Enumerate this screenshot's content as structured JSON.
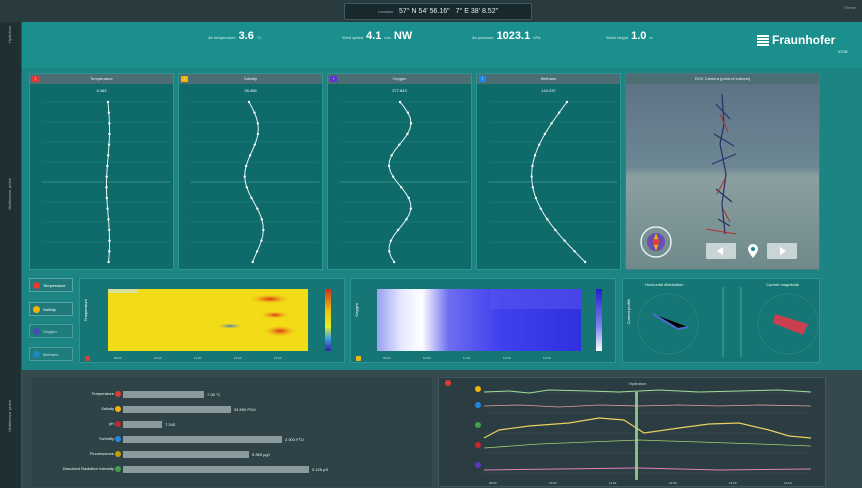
{
  "window": {
    "corner_label": "Theme"
  },
  "coords": {
    "lat_label": "Location",
    "lat": "57° N 54' 56.16\"",
    "lon": "7° E 38' 8.52\""
  },
  "sidebar": {
    "top_label": "Hydrobox",
    "mid_label": "Multisensor probe",
    "low_label": "Multisensor probe"
  },
  "header": {
    "air_temp": {
      "label": "Air temperature",
      "value": "3.6",
      "unit": "°C"
    },
    "wind": {
      "label": "Wind speed",
      "value": "4.1",
      "unit": "m/s",
      "dir": "NW"
    },
    "pressure": {
      "label": "Air pressure",
      "value": "1023.1",
      "unit": "hPa"
    },
    "wave": {
      "label": "Wave height",
      "value": "1.0",
      "unit": "m"
    },
    "logo_name": "Fraunhofer",
    "logo_sub": "IOSB",
    "logo_color": "#ffffff"
  },
  "profiles": [
    {
      "title": "Temperature",
      "value": "4.163",
      "color": "#e53935"
    },
    {
      "title": "Salinity",
      "value": "35.496",
      "color": "#f4b400"
    },
    {
      "title": "Oxygen",
      "value": "277.843",
      "color": "#5c35cc"
    },
    {
      "title": "Methane",
      "value": "144.237",
      "color": "#1e88e5"
    }
  ],
  "image_panel": {
    "title": "ROV Camera (point of interest)"
  },
  "controls": [
    {
      "label": "Temperature",
      "color": "#e53935"
    },
    {
      "label": "Salinity",
      "color": "#f4b400"
    },
    {
      "label": "Oxygen",
      "color": "#5c35cc"
    },
    {
      "label": "Methane",
      "color": "#1e88e5"
    }
  ],
  "heatmaps": [
    {
      "ylabel": "Temperature",
      "color": "#e53935"
    },
    {
      "ylabel": "Oxygen",
      "color": "#f4b400"
    }
  ],
  "current_panel": {
    "label": "Current profile",
    "t1": "Horizontal distribution",
    "t2": "Current magnitude"
  },
  "bars": [
    {
      "label": "Temperature",
      "value": "7.08",
      "unit": "°C",
      "color": "#e53935",
      "fraction": 0.27
    },
    {
      "label": "Salinity",
      "value": "34.590",
      "unit": "PSU",
      "color": "#f4b400",
      "fraction": 0.36
    },
    {
      "label": "pH",
      "value": "7.245",
      "unit": "",
      "color": "#c62828",
      "fraction": 0.13
    },
    {
      "label": "Turbidity",
      "value": "2.003",
      "unit": "FTU",
      "color": "#1e88e5",
      "fraction": 0.53
    },
    {
      "label": "Fluorescence",
      "value": "0.369",
      "unit": "µg/l",
      "color": "#c0a000",
      "fraction": 0.42
    },
    {
      "label": "Dissolved Radiation Intensity",
      "value": "0.126",
      "unit": "µS",
      "color": "#43a047",
      "fraction": 0.62
    }
  ],
  "timeseries": {
    "title": "Hydrobox",
    "icons": [
      "#e53935",
      "#f4b400",
      "#1e88e5",
      "#43a047",
      "#c62828",
      "#5c35cc"
    ]
  }
}
